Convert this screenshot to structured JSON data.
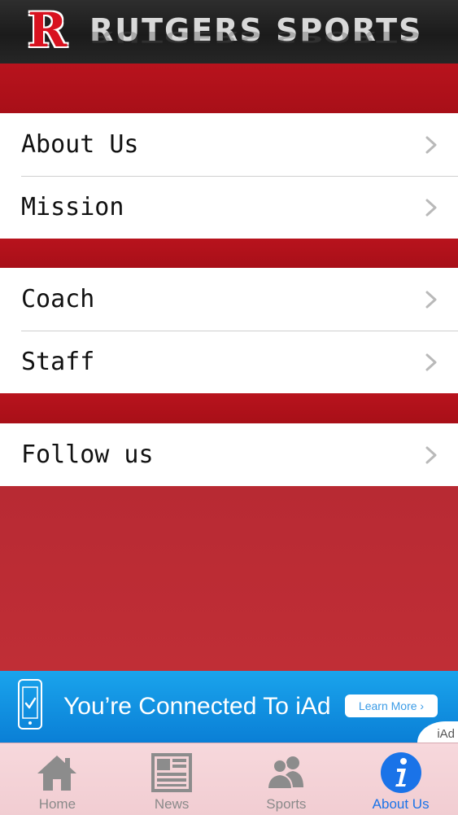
{
  "header": {
    "logo_letter": "R",
    "brand_title": "RUTGERS SPORTS"
  },
  "menu": {
    "groups": [
      {
        "items": [
          {
            "label": "About Us"
          },
          {
            "label": "Mission"
          }
        ]
      },
      {
        "items": [
          {
            "label": "Coach"
          },
          {
            "label": "Staff"
          }
        ]
      },
      {
        "items": [
          {
            "label": "Follow us"
          }
        ]
      }
    ]
  },
  "ad": {
    "text": "You’re Connected To iAd",
    "button_label": "Learn More ›",
    "tag": "iAd"
  },
  "tabbar": {
    "tabs": [
      {
        "label": "Home",
        "icon": "home-icon",
        "active": false
      },
      {
        "label": "News",
        "icon": "news-icon",
        "active": false
      },
      {
        "label": "Sports",
        "icon": "people-icon",
        "active": false
      },
      {
        "label": "About Us",
        "icon": "info-icon",
        "active": true
      }
    ]
  },
  "colors": {
    "brand_red": "#d8121f",
    "band_red": "#b8131d",
    "ad_blue": "#1aa4ec",
    "active_tab": "#1a73e8",
    "inactive_tab": "#8a8a8a"
  }
}
